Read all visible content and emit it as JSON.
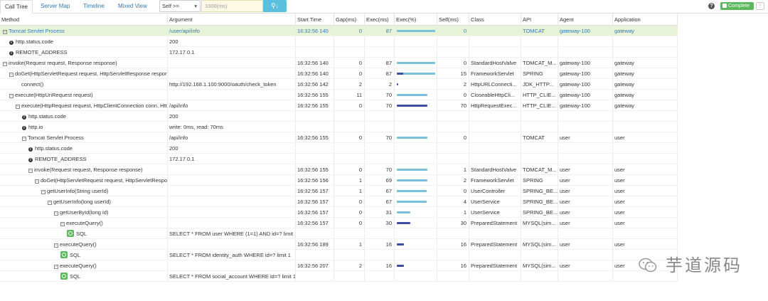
{
  "tabs": [
    {
      "label": "Call Tree",
      "active": true
    },
    {
      "label": "Server Map",
      "active": false
    },
    {
      "label": "Timeline",
      "active": false
    },
    {
      "label": "Mixed View",
      "active": false
    }
  ],
  "filter": {
    "selected": "Self >=",
    "placeholder": "1000(ms)"
  },
  "toolbar": {
    "complete_label": "Complete"
  },
  "columns": [
    "Method",
    "Argument",
    "Start Time",
    "Gap(ms)",
    "Exec(ms)",
    "Exec(%)",
    "Self(ms)",
    "Class",
    "API",
    "Agent",
    "Application"
  ],
  "rows": [
    {
      "level": 0,
      "kind": "toggle",
      "method": "Tomcat Servlet Process",
      "argument": "/user/api/info",
      "start": "16:32:56 140",
      "gap": "0",
      "exec": "87",
      "pct": 1.0,
      "bar_color": "#7ac0d8",
      "self": "0",
      "cls": "",
      "api": "TOMCAT",
      "agent": "gateway-100",
      "app": "gateway",
      "selected": true
    },
    {
      "level": 1,
      "kind": "info",
      "method": "http.status.code",
      "argument": "200",
      "start": "",
      "gap": "",
      "exec": "",
      "pct": null,
      "self": "",
      "cls": "",
      "api": "",
      "agent": "",
      "app": ""
    },
    {
      "level": 1,
      "kind": "info",
      "method": "REMOTE_ADDRESS",
      "argument": "172.17.0.1",
      "start": "",
      "gap": "",
      "exec": "",
      "pct": null,
      "self": "",
      "cls": "",
      "api": "",
      "agent": "",
      "app": ""
    },
    {
      "level": 0,
      "kind": "toggle",
      "method": "invoke(Request request, Response response)",
      "argument": "",
      "start": "16:32:56 140",
      "gap": "0",
      "exec": "87",
      "pct": 1.0,
      "bar_color": "#7ac0d8",
      "self": "0",
      "cls": "StandardHostValve",
      "api": "TOMCAT_M...",
      "agent": "gateway-100",
      "app": "gateway"
    },
    {
      "level": 1,
      "kind": "toggle",
      "method": "doGet(HttpServletRequest request, HttpServletResponse response)",
      "argument": "",
      "start": "16:32:56 140",
      "gap": "0",
      "exec": "87",
      "pct": 1.0,
      "bar_color": "#7ac0d8",
      "self_pct": 0.17,
      "self": "15",
      "cls": "FrameworkServlet",
      "api": "SPRING",
      "agent": "gateway-100",
      "app": "gateway"
    },
    {
      "level": 2,
      "kind": "plain",
      "method": "connect()",
      "argument": "http://192.168.1.100:9000/oauth/check_token",
      "start": "16:32:56 142",
      "gap": "2",
      "exec": "2",
      "pct": 0.03,
      "bar_color": "#3a4fa3",
      "self": "2",
      "cls": "HttpURLConnecti...",
      "api": "JDK_HTTP...",
      "agent": "gateway-100",
      "app": "gateway"
    },
    {
      "level": 1,
      "kind": "toggle",
      "method": "execute(HttpUriRequest request)",
      "argument": "",
      "start": "16:32:56 155",
      "gap": "11",
      "exec": "70",
      "pct": 0.8,
      "bar_color": "#7ac0d8",
      "self": "0",
      "cls": "CloseableHttpCli...",
      "api": "HTTP_CLIE...",
      "agent": "gateway-100",
      "app": "gateway"
    },
    {
      "level": 2,
      "kind": "toggle",
      "method": "execute(HttpRequest request, HttpClientConnection conn, HttpContext context)",
      "argument": "/api/info",
      "start": "16:32:56 155",
      "gap": "0",
      "exec": "70",
      "pct": 0.8,
      "bar_color": "#3a4fa3",
      "self": "70",
      "cls": "HttpRequestExec...",
      "api": "HTTP_CLIE...",
      "agent": "gateway-100",
      "app": "gateway"
    },
    {
      "level": 3,
      "kind": "info",
      "method": "http.status.code",
      "argument": "200",
      "start": "",
      "gap": "",
      "exec": "",
      "pct": null,
      "self": "",
      "cls": "",
      "api": "",
      "agent": "",
      "app": ""
    },
    {
      "level": 3,
      "kind": "info",
      "method": "http.io",
      "argument": "write: 0ms, read: 70ms",
      "start": "",
      "gap": "",
      "exec": "",
      "pct": null,
      "self": "",
      "cls": "",
      "api": "",
      "agent": "",
      "app": ""
    },
    {
      "level": 3,
      "kind": "toggle",
      "method": "Tomcat Servlet Process",
      "argument": "/api/info",
      "start": "16:32:56 155",
      "gap": "0",
      "exec": "70",
      "pct": 0.8,
      "bar_color": "#7ac0d8",
      "self": "0",
      "cls": "",
      "api": "TOMCAT",
      "agent": "user",
      "app": "user"
    },
    {
      "level": 4,
      "kind": "info",
      "method": "http.status.code",
      "argument": "200",
      "start": "",
      "gap": "",
      "exec": "",
      "pct": null,
      "self": "",
      "cls": "",
      "api": "",
      "agent": "",
      "app": ""
    },
    {
      "level": 4,
      "kind": "info",
      "method": "REMOTE_ADDRESS",
      "argument": "172.17.0.1",
      "start": "",
      "gap": "",
      "exec": "",
      "pct": null,
      "self": "",
      "cls": "",
      "api": "",
      "agent": "",
      "app": ""
    },
    {
      "level": 4,
      "kind": "toggle",
      "method": "invoke(Request request, Response response)",
      "argument": "",
      "start": "16:32:56 155",
      "gap": "0",
      "exec": "70",
      "pct": 0.8,
      "bar_color": "#7ac0d8",
      "self": "1",
      "cls": "StandardHostValve",
      "api": "TOMCAT_M...",
      "agent": "user",
      "app": "user"
    },
    {
      "level": 5,
      "kind": "toggle",
      "method": "doGet(HttpServletRequest request, HttpServletResponse response)",
      "argument": "",
      "start": "16:32:56 156",
      "gap": "1",
      "exec": "69",
      "pct": 0.79,
      "bar_color": "#7ac0d8",
      "self": "2",
      "cls": "FrameworkServlet",
      "api": "SPRING",
      "agent": "user",
      "app": "user"
    },
    {
      "level": 6,
      "kind": "toggle",
      "method": "getUserInfo(String userId)",
      "argument": "",
      "start": "16:32:56 157",
      "gap": "1",
      "exec": "67",
      "pct": 0.77,
      "bar_color": "#7ac0d8",
      "self": "0",
      "cls": "UserController",
      "api": "SPRING_BE...",
      "agent": "user",
      "app": "user"
    },
    {
      "level": 7,
      "kind": "toggle",
      "method": "getUserInfo(long userId)",
      "argument": "",
      "start": "16:32:56 157",
      "gap": "0",
      "exec": "67",
      "pct": 0.77,
      "bar_color": "#7ac0d8",
      "self": "4",
      "cls": "UserService",
      "api": "SPRING_BE...",
      "agent": "user",
      "app": "user"
    },
    {
      "level": 8,
      "kind": "toggle",
      "method": "getUserById(long id)",
      "argument": "",
      "start": "16:32:56 157",
      "gap": "0",
      "exec": "31",
      "pct": 0.36,
      "bar_color": "#7ac0d8",
      "self": "1",
      "cls": "UserService",
      "api": "SPRING_BE...",
      "agent": "user",
      "app": "user"
    },
    {
      "level": 9,
      "kind": "toggle",
      "method": "executeQuery()",
      "argument": "",
      "start": "16:32:56 157",
      "gap": "0",
      "exec": "30",
      "pct": 0.35,
      "bar_color": "#3a4fa3",
      "self": "30",
      "cls": "PreparedStatement",
      "api": "MYSQL(sim...",
      "agent": "user",
      "app": "user"
    },
    {
      "level": 10,
      "kind": "sql",
      "method": "SQL",
      "argument": "SELECT * FROM user WHERE (1=1) AND id=? limit 1",
      "start": "",
      "gap": "",
      "exec": "",
      "pct": null,
      "self": "",
      "cls": "",
      "api": "",
      "agent": "",
      "app": ""
    },
    {
      "level": 8,
      "kind": "toggle",
      "method": "executeQuery()",
      "argument": "",
      "start": "16:32:56 189",
      "gap": "1",
      "exec": "16",
      "pct": 0.18,
      "bar_color": "#3a4fa3",
      "self": "16",
      "cls": "PreparedStatement",
      "api": "MYSQL(sim...",
      "agent": "user",
      "app": "user"
    },
    {
      "level": 9,
      "kind": "sql",
      "method": "SQL",
      "argument": "SELECT * FROM identity_auth WHERE id=? limit 1",
      "start": "",
      "gap": "",
      "exec": "",
      "pct": null,
      "self": "",
      "cls": "",
      "api": "",
      "agent": "",
      "app": ""
    },
    {
      "level": 8,
      "kind": "toggle",
      "method": "executeQuery()",
      "argument": "",
      "start": "16:32:56 207",
      "gap": "2",
      "exec": "16",
      "pct": 0.18,
      "bar_color": "#3a4fa3",
      "self": "16",
      "cls": "PreparedStatement",
      "api": "MYSQL(sim...",
      "agent": "user",
      "app": "user"
    },
    {
      "level": 9,
      "kind": "sql",
      "method": "SQL",
      "argument": "SELECT * FROM social_account WHERE id=? limit 1",
      "start": "",
      "gap": "",
      "exec": "",
      "pct": null,
      "self": "",
      "cls": "",
      "api": "",
      "agent": "",
      "app": ""
    }
  ],
  "watermark": {
    "text": "芋道源码"
  }
}
